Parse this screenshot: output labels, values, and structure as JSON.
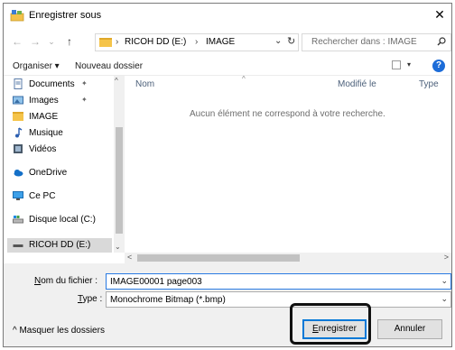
{
  "window": {
    "title": "Enregistrer sous",
    "close_label": "✕"
  },
  "nav": {
    "back_label": "←",
    "forward_label": "→",
    "history_label": "⌄",
    "up_label": "↑",
    "breadcrumb": [
      "RICOH DD (E:)",
      "IMAGE"
    ],
    "separator": "›",
    "dropdown_label": "⌄",
    "refresh_label": "↻"
  },
  "search": {
    "placeholder": "Rechercher dans : IMAGE"
  },
  "toolbar": {
    "organize_label": "Organiser ▾",
    "new_folder_label": "Nouveau dossier",
    "view_dropdown_label": "▾",
    "help_label": "?"
  },
  "sidebar": {
    "items": [
      {
        "label": "Documents",
        "icon": "documents-icon",
        "pinned": true
      },
      {
        "label": "Images",
        "icon": "pictures-icon",
        "pinned": true
      },
      {
        "label": "IMAGE",
        "icon": "folder-icon",
        "pinned": false
      },
      {
        "label": "Musique",
        "icon": "music-icon",
        "pinned": false
      },
      {
        "label": "Vidéos",
        "icon": "videos-icon",
        "pinned": false
      },
      {
        "label": "OneDrive",
        "icon": "onedrive-icon",
        "pinned": false
      },
      {
        "label": "Ce PC",
        "icon": "this-pc-icon",
        "pinned": false
      },
      {
        "label": "Disque local (C:)",
        "icon": "local-disk-icon",
        "pinned": false
      },
      {
        "label": "RICOH DD (E:)",
        "icon": "usb-drive-icon",
        "pinned": false,
        "selected": true
      }
    ],
    "pin_glyph": "✦",
    "scroll_up": "^",
    "scroll_down": "⌄"
  },
  "files": {
    "columns": [
      "Nom",
      "Modifié le",
      "Type"
    ],
    "sort_indicator": "^",
    "empty_message": "Aucun élément ne correspond à votre recherche.",
    "hscroll_left": "<",
    "hscroll_right": ">"
  },
  "form": {
    "filename_label_underlined": "N",
    "filename_label_rest": "om du fichier :",
    "filename_value": "IMAGE00001 page003",
    "type_label_underlined": "T",
    "type_label_rest": "ype :",
    "type_value": "Monochrome Bitmap (*.bmp)",
    "dropdown_glyph": "⌄"
  },
  "footer": {
    "hide_folders_label": "^  Masquer les dossiers",
    "save_label_underlined": "E",
    "save_label_rest": "nregistrer",
    "cancel_label": "Annuler"
  },
  "colors": {
    "accent": "#0078d7",
    "folder": "#f5c44a",
    "selection": "#d9d9d9",
    "help": "#1c6cd8"
  }
}
